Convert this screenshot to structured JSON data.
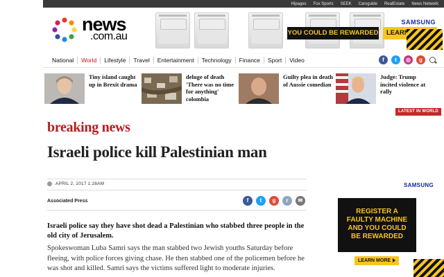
{
  "topbar": {
    "links": [
      "Hipages",
      "Fox Sports",
      "SEEK",
      "Carsguide",
      "RealEstate",
      "News Network"
    ]
  },
  "logo": {
    "name": "news",
    "domain": ".com.au"
  },
  "ad": {
    "reward_text": "YOU COULD BE REWARDED",
    "learn_more": "LEARN MORE",
    "brand": "SAMSUNG"
  },
  "nav": {
    "items": [
      {
        "label": "National",
        "active": false
      },
      {
        "label": "World",
        "active": true
      },
      {
        "label": "Lifestyle",
        "active": false
      },
      {
        "label": "Travel",
        "active": false
      },
      {
        "label": "Entertainment",
        "active": false
      },
      {
        "label": "Technology",
        "active": false
      },
      {
        "label": "Finance",
        "active": false
      },
      {
        "label": "Sport",
        "active": false
      },
      {
        "label": "Video",
        "active": false
      }
    ],
    "social": [
      "facebook-icon",
      "twitter-icon",
      "instagram-icon",
      "google-plus-icon",
      "search-icon"
    ]
  },
  "strip": {
    "items": [
      {
        "title": "Tiny island caught up in Brexit drama"
      },
      {
        "title": "deluge of death 'There was no time for anything' colombia"
      },
      {
        "title": "Guilty plea in death of Aussie comedian"
      },
      {
        "title": "Judge: Trump incited violence at rally"
      }
    ]
  },
  "latest_badge": "LATEST IN WORLD",
  "article": {
    "section": "breaking news",
    "headline": "Israeli police kill Palestinian man",
    "date": "APRIL 2, 2017 1:28AM",
    "byline": "Associated Press",
    "lede": "Israeli police say they have shot dead a Palestinian who stabbed three people in the old city of Jerusalem.",
    "body": "Spokeswoman Luba Samri says the man stabbed two Jewish youths Saturday before fleeing, with police forces giving chase. He then stabbed one of the policemen before he was shot and killed. Samri says the victims suffered light to moderate injuries."
  },
  "side_ad": {
    "brand": "SAMSUNG",
    "text": "REGISTER A\nFAULTY MACHINE\nAND YOU COULD\nBE REWARDED",
    "learn_more": "LEARN MORE"
  },
  "colors": {
    "accent_red": "#b71c1c",
    "ad_yellow": "#f7c520",
    "samsung_blue": "#1428a0",
    "facebook": "#3b5998",
    "twitter": "#1da1f2"
  }
}
